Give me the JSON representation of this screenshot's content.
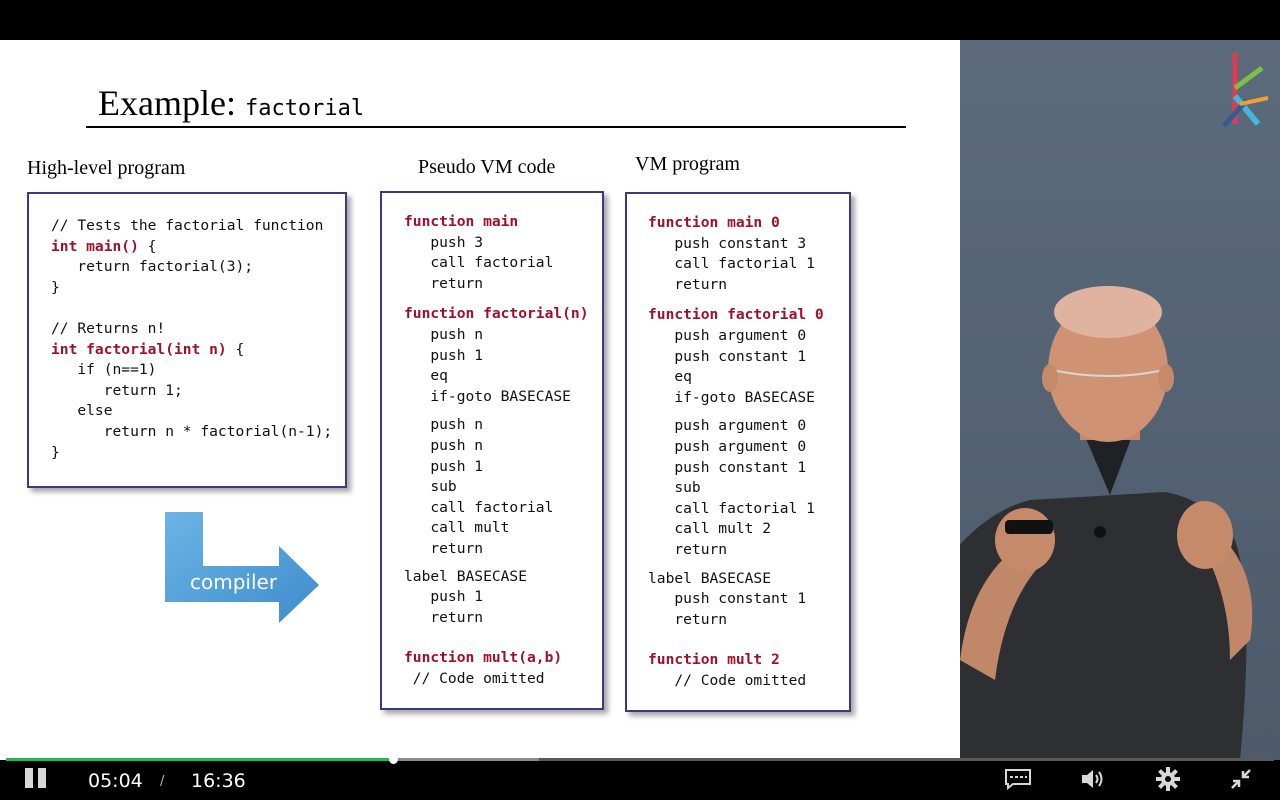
{
  "slide": {
    "title_text": "Example:",
    "title_code": "factorial",
    "labels": {
      "high_level": "High-level program",
      "pseudo_vm": "Pseudo VM code",
      "vm_program": "VM program",
      "compiler": "compiler"
    },
    "high_level_code": [
      [
        {
          "t": "// Tests the factorial function"
        }
      ],
      [
        {
          "t": "int main() ",
          "k": 1
        },
        {
          "t": "{"
        }
      ],
      [
        {
          "t": "   return factorial(3);"
        }
      ],
      [
        {
          "t": "}"
        }
      ],
      [
        {
          "t": ""
        }
      ],
      [
        {
          "t": "// Returns n!"
        }
      ],
      [
        {
          "t": "int factorial(int n) ",
          "k": 1
        },
        {
          "t": "{"
        }
      ],
      [
        {
          "t": "   if (n==1)"
        }
      ],
      [
        {
          "t": "      return 1;"
        }
      ],
      [
        {
          "t": "   else"
        }
      ],
      [
        {
          "t": "      return n * factorial(n-1);"
        }
      ],
      [
        {
          "t": "}"
        }
      ]
    ],
    "pseudo_vm_code": [
      [
        {
          "t": "function main",
          "k": 1
        }
      ],
      [
        {
          "t": "   push 3"
        }
      ],
      [
        {
          "t": "   call factorial"
        }
      ],
      [
        {
          "t": "   return"
        }
      ],
      [
        {
          "t": "function factorial(n)",
          "k": 1
        }
      ],
      [
        {
          "t": "   push n"
        }
      ],
      [
        {
          "t": "   push 1"
        }
      ],
      [
        {
          "t": "   eq"
        }
      ],
      [
        {
          "t": "   if-goto BASECASE"
        }
      ],
      [
        {
          "t": "   push n"
        }
      ],
      [
        {
          "t": "   push n"
        }
      ],
      [
        {
          "t": "   push 1"
        }
      ],
      [
        {
          "t": "   sub"
        }
      ],
      [
        {
          "t": "   call factorial"
        }
      ],
      [
        {
          "t": "   call mult"
        }
      ],
      [
        {
          "t": "   return"
        }
      ],
      [
        {
          "t": "label BASECASE"
        }
      ],
      [
        {
          "t": "   push 1"
        }
      ],
      [
        {
          "t": "   return"
        }
      ],
      [
        {
          "t": "function mult(a,b)",
          "k": 1
        }
      ],
      [
        {
          "t": " // Code omitted"
        }
      ]
    ],
    "vm_program_code": [
      [
        {
          "t": "function main 0",
          "k": 1
        }
      ],
      [
        {
          "t": "   push constant 3"
        }
      ],
      [
        {
          "t": "   call factorial 1"
        }
      ],
      [
        {
          "t": "   return"
        }
      ],
      [
        {
          "t": "function factorial 0",
          "k": 1
        }
      ],
      [
        {
          "t": "   push argument 0"
        }
      ],
      [
        {
          "t": "   push constant 1"
        }
      ],
      [
        {
          "t": "   eq"
        }
      ],
      [
        {
          "t": "   if-goto BASECASE"
        }
      ],
      [
        {
          "t": "   push argument 0"
        }
      ],
      [
        {
          "t": "   push argument 0"
        }
      ],
      [
        {
          "t": "   push constant 1"
        }
      ],
      [
        {
          "t": "   sub"
        }
      ],
      [
        {
          "t": "   call factorial 1"
        }
      ],
      [
        {
          "t": "   call mult 2"
        }
      ],
      [
        {
          "t": "   return"
        }
      ],
      [
        {
          "t": "label BASECASE"
        }
      ],
      [
        {
          "t": "   push constant 1"
        }
      ],
      [
        {
          "t": "   return"
        }
      ],
      [
        {
          "t": "function mult 2",
          "k": 1
        }
      ],
      [
        {
          "t": "   // Code omitted"
        }
      ]
    ]
  },
  "player": {
    "current_time": "05:04",
    "separator": "/",
    "duration": "16:36",
    "progress_fraction": 0.305,
    "buffered_fraction": 0.42,
    "icons": {
      "play_pause": "pause-icon",
      "captions": "captions-icon",
      "volume": "volume-icon",
      "settings": "gear-icon",
      "fullscreen": "exit-fullscreen-icon"
    },
    "colors": {
      "progress": "#1db954",
      "track": "#5a5a5a",
      "buffer": "#8a8a8a"
    }
  },
  "colors": {
    "keyword": "#a0102a",
    "box_border": "#3a3a80",
    "panel": "#566474",
    "arrow": "#4a9ad6"
  }
}
